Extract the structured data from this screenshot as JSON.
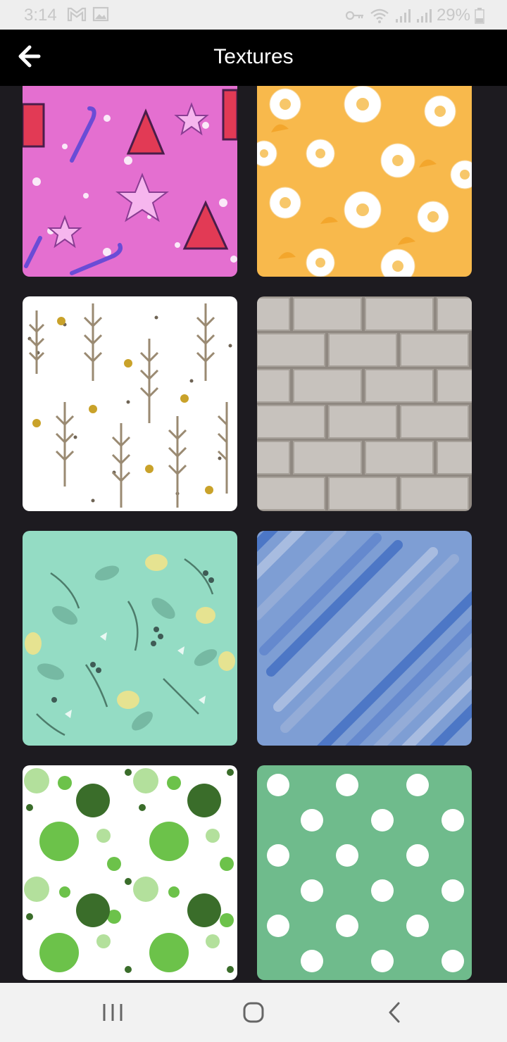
{
  "status_bar": {
    "time": "3:14",
    "battery": "29%",
    "icons": [
      "gmail-icon",
      "gallery-icon",
      "key-icon",
      "wifi-icon",
      "signal-icon",
      "signal-icon-2",
      "battery-icon"
    ]
  },
  "app_bar": {
    "title": "Textures",
    "back_icon": "back-arrow-icon"
  },
  "textures": [
    {
      "name": "christmas-cookies",
      "colors": [
        "#e46fd0",
        "#e23a55",
        "#ffffff"
      ]
    },
    {
      "name": "daisy-flowers",
      "colors": [
        "#f8b94c",
        "#ffffff",
        "#f3a62c"
      ]
    },
    {
      "name": "feathers-leaves",
      "colors": [
        "#ffffff",
        "#9a8a72",
        "#c9a22a"
      ]
    },
    {
      "name": "stone-bricks",
      "colors": [
        "#c7c2bd",
        "#8f8881"
      ]
    },
    {
      "name": "mint-botanical",
      "colors": [
        "#94dcc4",
        "#4d7c6b",
        "#e6e391"
      ]
    },
    {
      "name": "blue-diagonal-streaks",
      "colors": [
        "#6b8fcf",
        "#3d6ac2",
        "#9cb1d9"
      ]
    },
    {
      "name": "green-circles",
      "colors": [
        "#ffffff",
        "#6cc24a",
        "#3a6d2a",
        "#b3e09c"
      ]
    },
    {
      "name": "green-polka-dots",
      "colors": [
        "#6fbb8c",
        "#ffffff"
      ]
    }
  ],
  "nav_bar": {
    "icons": [
      "recent-apps-icon",
      "home-icon",
      "back-icon"
    ],
    "background": "#f2f2f2"
  }
}
